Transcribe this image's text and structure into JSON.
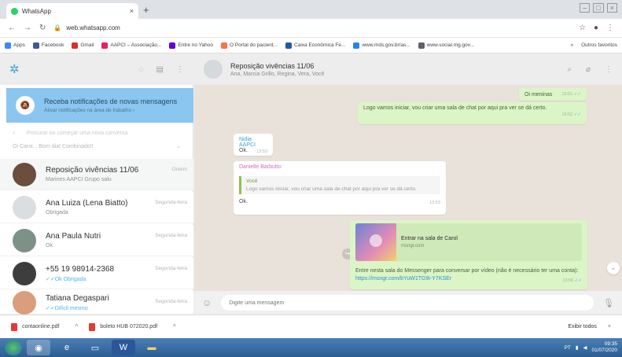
{
  "browser": {
    "tab_title": "WhatsApp",
    "tab_close": "×",
    "new_tab": "+",
    "url": "web.whatsapp.com",
    "bookmarks": [
      {
        "label": "Apps",
        "color": "#4285f4"
      },
      {
        "label": "Facebook",
        "color": "#3b5998"
      },
      {
        "label": "Gmail",
        "color": "#d93025"
      },
      {
        "label": "AAPCI – Associação...",
        "color": "#e91e63"
      },
      {
        "label": "Entre no Yahoo",
        "color": "#6001d2"
      },
      {
        "label": "O Portal do pacient...",
        "color": "#ff7043"
      },
      {
        "label": "Caixa Econômica Fe...",
        "color": "#1c5aa6"
      },
      {
        "label": "www.mds.gov.br/as...",
        "color": "#1e88e5"
      },
      {
        "label": "www.social.mg.gov...",
        "color": "#5f6368"
      }
    ],
    "bookmarks_more": "»",
    "other_bookmarks": "Outros favoritos"
  },
  "sidebar": {
    "notification": {
      "title": "Receba notificações de novas mensagens",
      "subtitle": "Ativar notificações na área de trabalho ›"
    },
    "search_placeholder": "Procurar ou começar uma nova conversa",
    "pinned_preview": "Oi Caroi... Bom dia!  Combinado!!",
    "chats": [
      {
        "name": "Reposição vivências 11/06",
        "preview": "Marines AAPCI Grupo salu",
        "time": "Ontem"
      },
      {
        "name": "Ana Luiza (Lena Biatto)",
        "preview": "Obrigada",
        "time": "Segunda-feira"
      },
      {
        "name": "Ana Paula Nutri",
        "preview": "Ok",
        "time": "Segunda-feira"
      },
      {
        "name": "+55 19 98914-2368",
        "preview": "✓✓Ok Obrigada",
        "time": "Segunda-feira"
      },
      {
        "name": "Tatiana Degaspari",
        "preview": "✓✓Difícil mesmo",
        "time": "Segunda-feira"
      }
    ]
  },
  "conversation": {
    "title": "Reposição vivências 11/06",
    "members": "Ana, Marcia Grillo, Regina, Vera, Você",
    "messages": {
      "m1": {
        "text": "Oi meninas",
        "time": "13:51"
      },
      "m2": {
        "text": "Logo vamos iniciar, vou criar uma sala de chat por aqui pra ver se dá certo.",
        "time": "13:52"
      },
      "m3": {
        "sender": "Nidia AAPCI",
        "text": "Ok.",
        "time": "13:53"
      },
      "m4": {
        "sender": "Danielle Barbutto",
        "quote_author": "Você",
        "quote_text": "Logo vamos iniciar, vou criar uma sala de chat por aqui pra ver se dá certo.",
        "text": "Ok.",
        "time": "13:53"
      },
      "m5": {
        "link_title": "Entrar na sala de Carol",
        "link_domain": "msngr.com",
        "text": "Entre nesta sala do Messenger para conversar por vídeo (não é necessário ter uma conta):",
        "link": "https://msngr.com/bYuW1TG9i-Y7KSEr",
        "time": "13:56"
      }
    },
    "compose_placeholder": "Digite uma mensagem"
  },
  "downloads": {
    "files": [
      "contaonline.pdf",
      "boleto HUB 072020.pdf"
    ],
    "show_all": "Exibir todos",
    "close": "×"
  },
  "taskbar": {
    "time": "09:35",
    "date": "01/07/2020"
  }
}
